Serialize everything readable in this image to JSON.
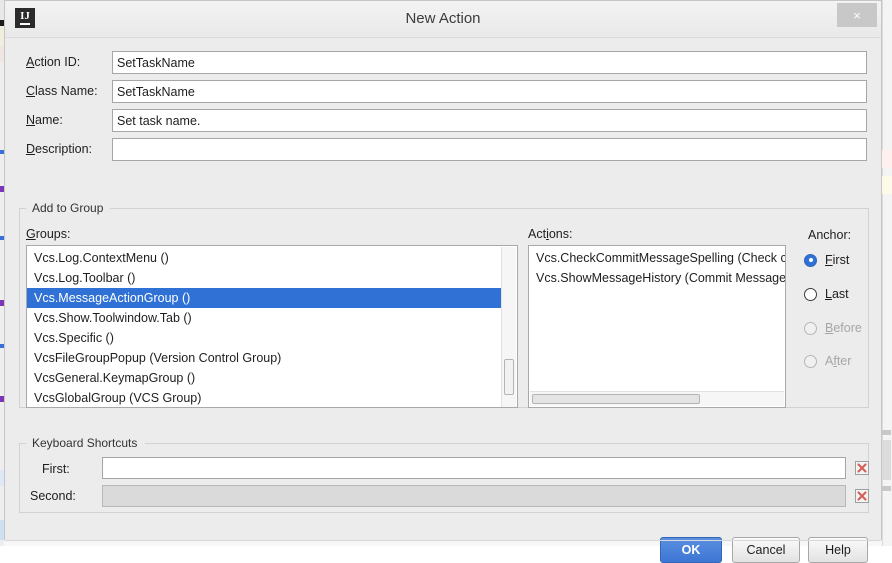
{
  "window": {
    "title": "New Action",
    "app_icon": "intellij-idea-icon",
    "close_label": "×"
  },
  "form": {
    "fields": [
      {
        "label_pre": "",
        "label_mn": "A",
        "label_post": "ction ID:",
        "value": "SetTaskName",
        "name": "action-id"
      },
      {
        "label_pre": "",
        "label_mn": "C",
        "label_post": "lass Name:",
        "value": "SetTaskName",
        "name": "class-name"
      },
      {
        "label_pre": "",
        "label_mn": "N",
        "label_post": "ame:",
        "value": "Set task name.",
        "name": "name"
      },
      {
        "label_pre": "",
        "label_mn": "D",
        "label_post": "escription:",
        "value": "",
        "name": "description"
      }
    ]
  },
  "add_to_group": {
    "title": "Add to Group",
    "groups": {
      "label_mn": "G",
      "label_post": "roups:",
      "items": [
        "Vcs.Log.ContextMenu ()",
        "Vcs.Log.Toolbar ()",
        "Vcs.MessageActionGroup ()",
        "Vcs.Show.Toolwindow.Tab ()",
        "Vcs.Specific ()",
        "VcsFileGroupPopup (Version Control Group)",
        "VcsGeneral.KeymapGroup ()",
        "VcsGlobalGroup (VCS Group)"
      ],
      "selected_index": 2
    },
    "actions": {
      "label_pre": "Act",
      "label_mn": "i",
      "label_post": "ons:",
      "items": [
        "Vcs.CheckCommitMessageSpelling (Check c",
        "Vcs.ShowMessageHistory (Commit Message"
      ]
    },
    "anchor": {
      "label": "Anchor:",
      "options": [
        {
          "pre": "",
          "mn": "F",
          "post": "irst",
          "state": "selected",
          "name": "anchor-first"
        },
        {
          "pre": "",
          "mn": "L",
          "post": "ast",
          "state": "enabled",
          "name": "anchor-last"
        },
        {
          "pre": "",
          "mn": "B",
          "post": "efore",
          "state": "disabled",
          "name": "anchor-before"
        },
        {
          "pre": "A",
          "mn": "f",
          "post": "ter",
          "state": "disabled",
          "name": "anchor-after"
        }
      ]
    }
  },
  "keyboard_shortcuts": {
    "title": "Keyboard Shortcuts",
    "rows": [
      {
        "label": "First:",
        "value": "",
        "disabled": false,
        "clear_icon": "clear-x-icon",
        "name": "shortcut-first"
      },
      {
        "label": "Second:",
        "value": "",
        "disabled": true,
        "clear_icon": "clear-x-icon",
        "name": "shortcut-second"
      }
    ]
  },
  "buttons": {
    "ok": "OK",
    "cancel": "Cancel",
    "help": "Help"
  },
  "colors": {
    "accent": "#2f71d4",
    "selection": "#2f71d4",
    "dialog_bg": "#ececec",
    "clear_icon_red": "#d4635b"
  }
}
